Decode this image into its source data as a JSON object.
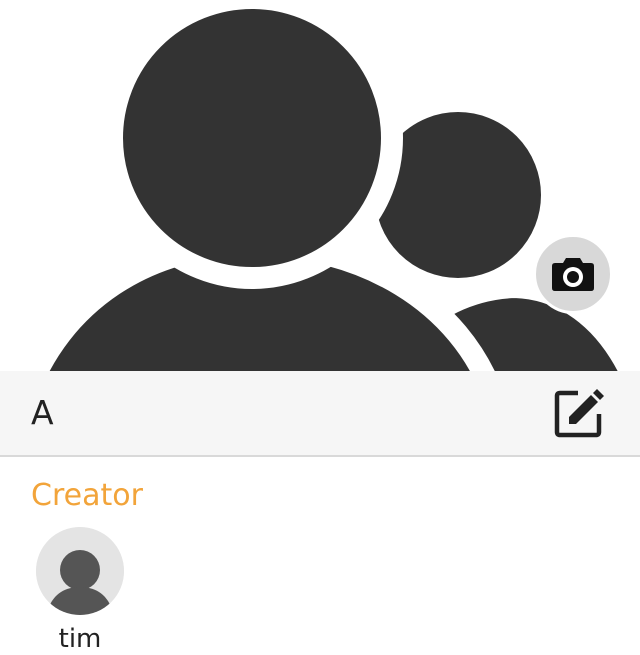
{
  "header": {
    "image_icon": "group-people-icon",
    "camera_icon": "camera-icon"
  },
  "group": {
    "name": "A",
    "edit_icon": "edit-icon"
  },
  "section": {
    "title": "Creator"
  },
  "creator": {
    "name": "tim",
    "avatar_icon": "person-icon"
  },
  "colors": {
    "accent": "#f2a43a",
    "silhouette": "#333333",
    "name_bar_bg": "#f6f6f6",
    "avatar_bg": "#e4e4e4"
  }
}
